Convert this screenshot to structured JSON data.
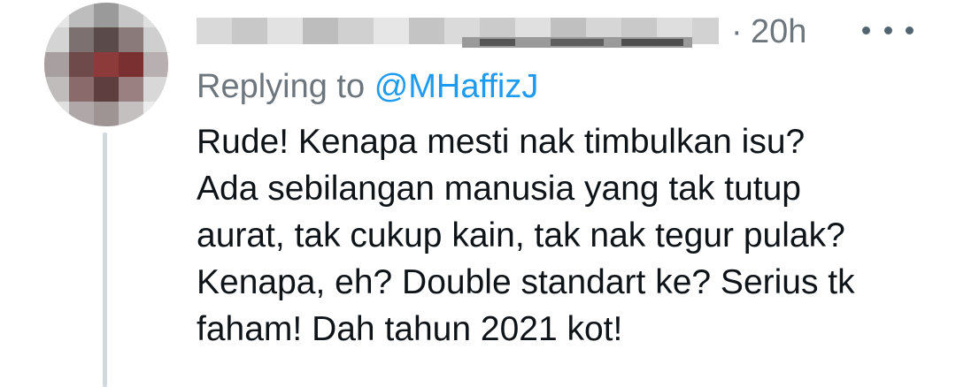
{
  "tweet": {
    "timestamp": "20h",
    "separator": "·",
    "more_icon": "more-horizontal-icon",
    "replying_prefix": "Replying to",
    "replying_handle": "@MHaffizJ",
    "body_lines": [
      "Rude! Kenapa mesti nak timbulkan isu?",
      "Ada sebilangan manusia yang tak tutup",
      "aurat, tak cukup kain, tak nak tegur pulak?",
      "Kenapa, eh? Double standart ke? Serius tk",
      "faham! Dah tahun 2021 kot!"
    ]
  },
  "colors": {
    "text": "#0f1419",
    "secondary": "#6e767d",
    "link": "#1d9bf0",
    "thread_line": "#cfd9de"
  }
}
